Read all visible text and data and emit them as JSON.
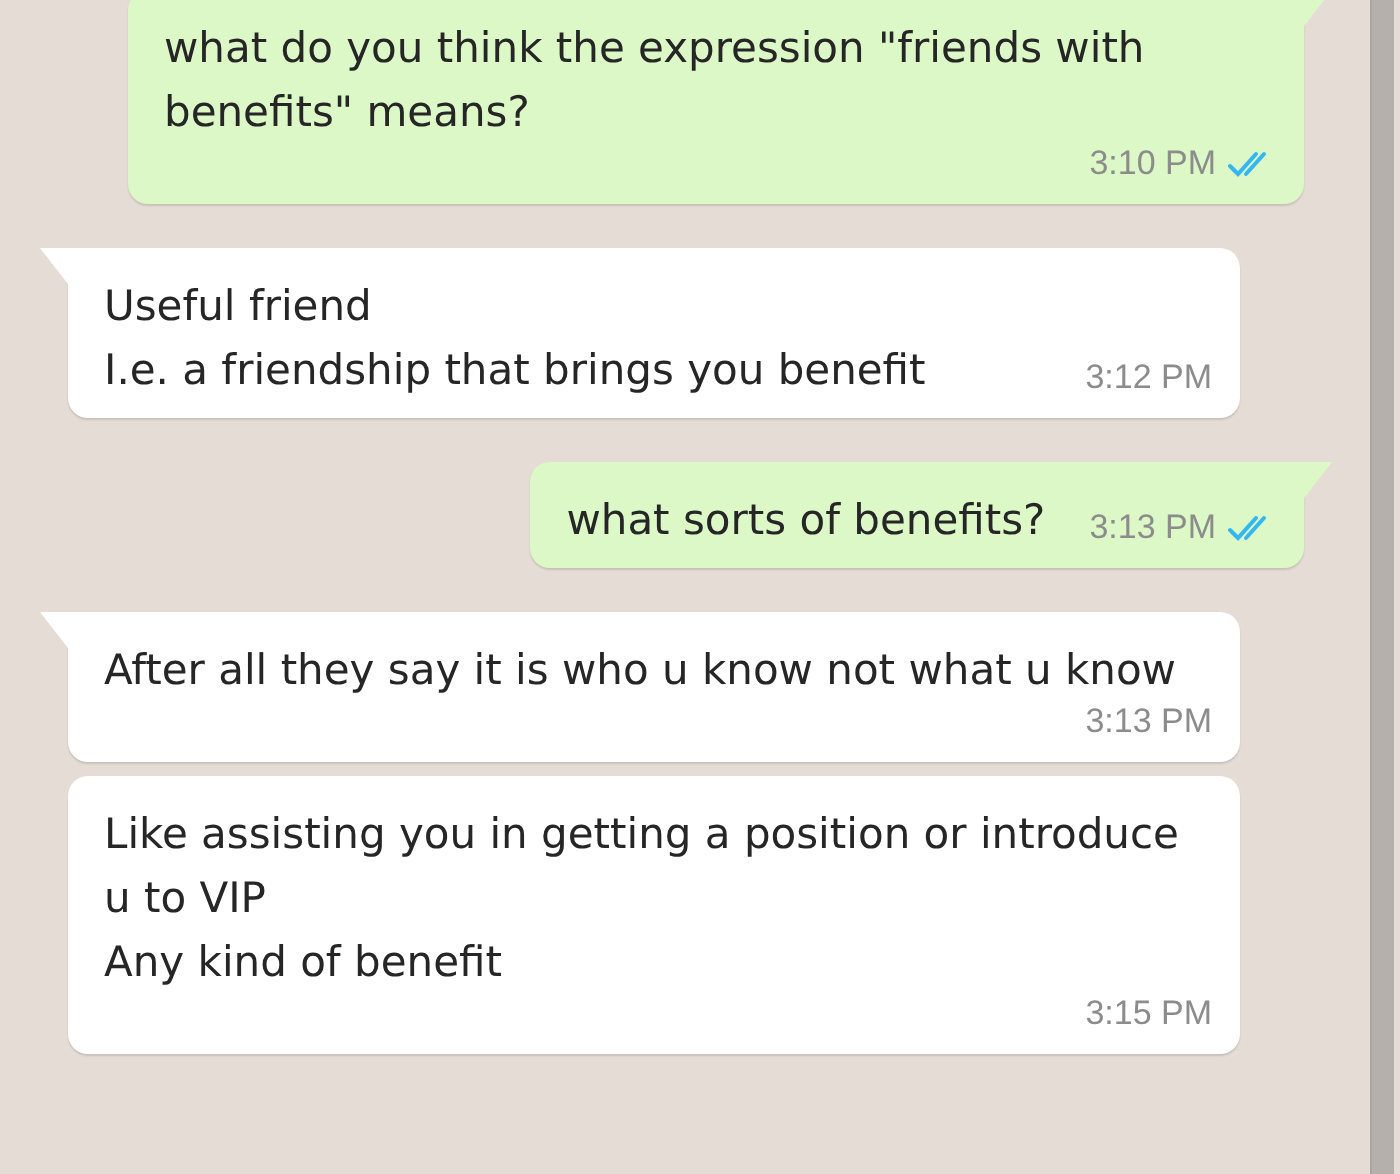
{
  "messages": [
    {
      "kind": "out",
      "tail": true,
      "text": "what do you think the expression \"friends with benefits\" means?",
      "time": "3:10 PM",
      "read": true
    },
    {
      "kind": "in",
      "tail": true,
      "text": "Useful friend\nI.e. a friendship that brings you benefit",
      "time": "3:12 PM"
    },
    {
      "kind": "out",
      "tail": true,
      "text": "what sorts of benefits?",
      "time": "3:13 PM",
      "read": true
    },
    {
      "kind": "in",
      "tail": true,
      "text": "After all they say it is who u know not what u know",
      "time": "3:13 PM"
    },
    {
      "kind": "in",
      "tail": false,
      "text": "Like assisting you in getting a position or introduce u to VIP\nAny kind of benefit",
      "time": "3:15 PM"
    }
  ]
}
